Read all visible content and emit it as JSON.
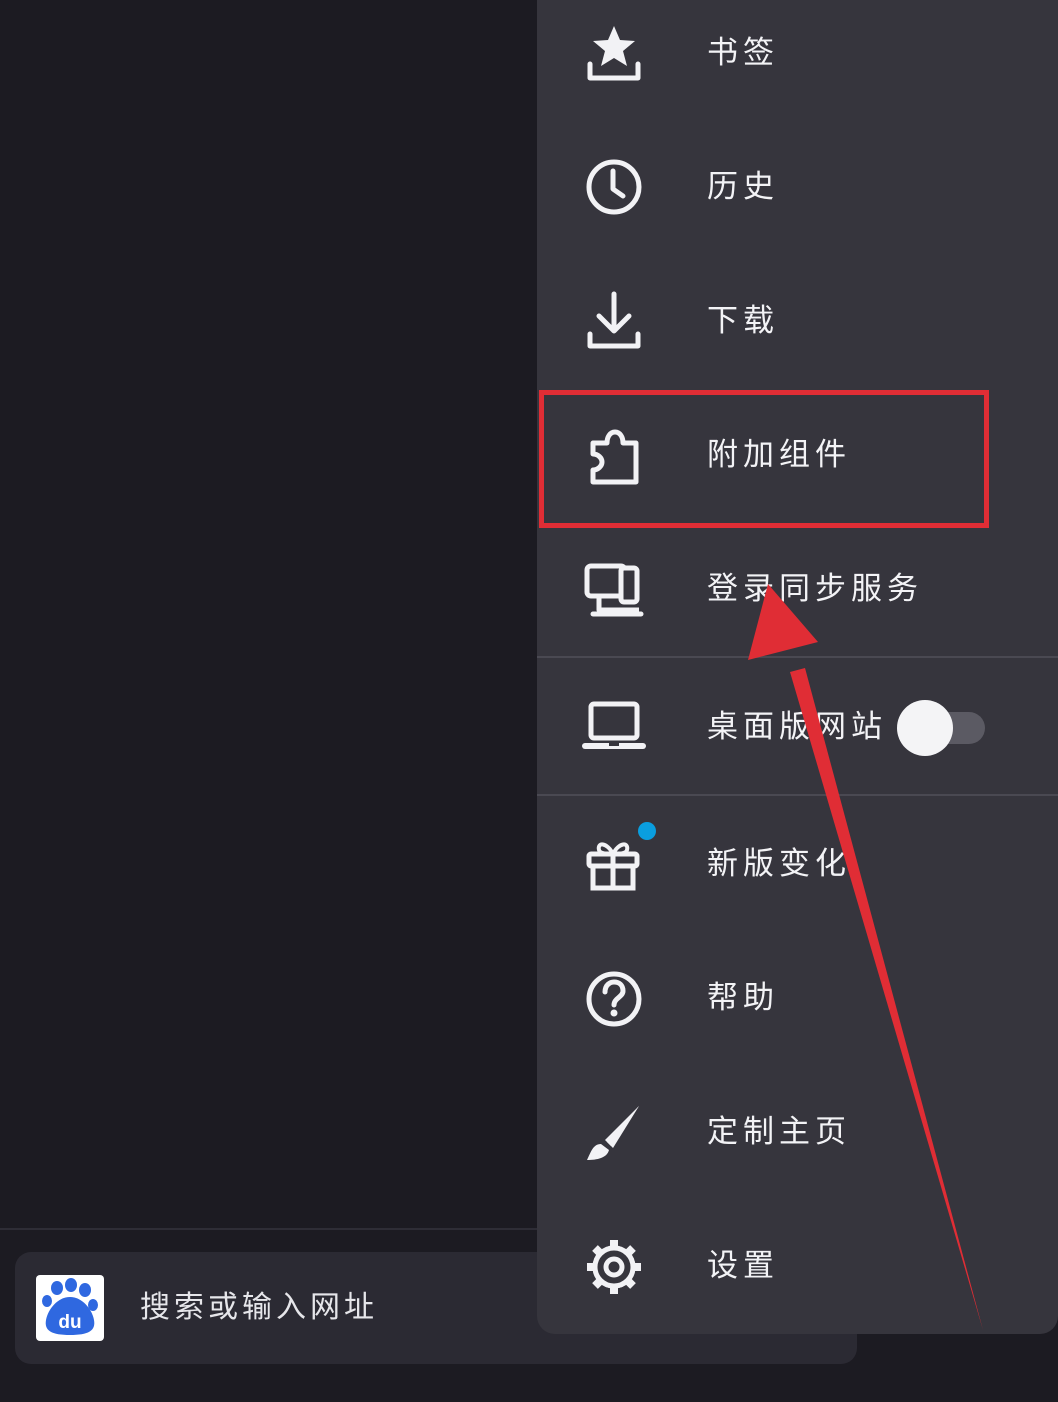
{
  "address_bar": {
    "placeholder": "搜索或输入网址",
    "engine_icon": "baidu-paw-icon",
    "engine_logo_text": "du"
  },
  "menu": {
    "items": [
      {
        "label": "书签",
        "icon": "bookmark-star-icon"
      },
      {
        "label": "历史",
        "icon": "clock-icon"
      },
      {
        "label": "下载",
        "icon": "download-icon"
      },
      {
        "label": "附加组件",
        "icon": "puzzle-icon"
      },
      {
        "label": "登录同步服务",
        "icon": "sync-devices-icon"
      },
      {
        "label": "桌面版网站",
        "icon": "laptop-icon",
        "toggle_on": false
      },
      {
        "label": "新版变化",
        "icon": "gift-icon",
        "badge": true
      },
      {
        "label": "帮助",
        "icon": "help-circle-icon"
      },
      {
        "label": "定制主页",
        "icon": "brush-icon"
      },
      {
        "label": "设置",
        "icon": "gear-icon"
      }
    ]
  },
  "annotation": {
    "highlight_color": "#e02d35",
    "highlighted_item": "附加组件"
  },
  "colors": {
    "background": "#1c1b22",
    "menu_background": "#36353d",
    "badge": "#0a9edf"
  }
}
